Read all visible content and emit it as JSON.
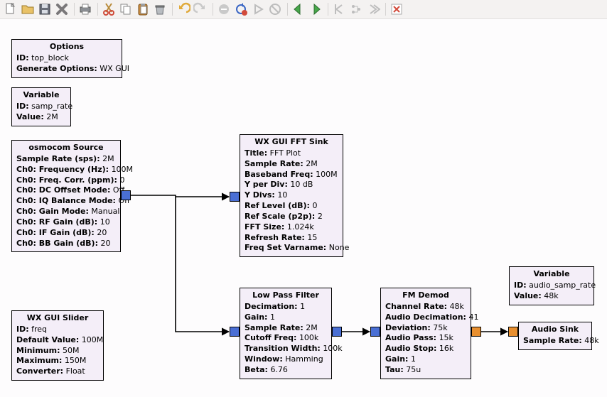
{
  "toolbar": {
    "icons": [
      "new-file-icon",
      "open-folder-icon",
      "save-icon",
      "close-icon",
      "sep",
      "print-icon",
      "sep",
      "cut-icon",
      "copy-icon",
      "paste-icon",
      "delete-icon",
      "sep",
      "undo-icon",
      "redo-icon",
      "sep",
      "stop-icon",
      "rebuild-icon",
      "run-icon",
      "kill-icon",
      "sep",
      "back-icon",
      "forward-icon",
      "sep",
      "collapse-icon",
      "tree-icon",
      "expand-icon",
      "sep",
      "error-icon"
    ]
  },
  "blocks": {
    "options": {
      "title": "Options",
      "rows": [
        {
          "label": "ID:",
          "value": "top_block"
        },
        {
          "label": "Generate Options:",
          "value": "WX GUI"
        }
      ]
    },
    "var_samp_rate": {
      "title": "Variable",
      "rows": [
        {
          "label": "ID:",
          "value": "samp_rate"
        },
        {
          "label": "Value:",
          "value": "2M"
        }
      ]
    },
    "osmocom": {
      "title": "osmocom Source",
      "rows": [
        {
          "label": "Sample Rate (sps):",
          "value": "2M"
        },
        {
          "label": "Ch0: Frequency (Hz):",
          "value": "100M"
        },
        {
          "label": "Ch0: Freq. Corr. (ppm):",
          "value": "0"
        },
        {
          "label": "Ch0: DC Offset Mode:",
          "value": "Off"
        },
        {
          "label": "Ch0: IQ Balance Mode:",
          "value": "Off"
        },
        {
          "label": "Ch0: Gain Mode:",
          "value": "Manual"
        },
        {
          "label": "Ch0: RF Gain (dB):",
          "value": "10"
        },
        {
          "label": "Ch0: IF Gain (dB):",
          "value": "20"
        },
        {
          "label": "Ch0: BB Gain (dB):",
          "value": "20"
        }
      ]
    },
    "fft": {
      "title": "WX GUI FFT Sink",
      "rows": [
        {
          "label": "Title:",
          "value": "FFT Plot"
        },
        {
          "label": "Sample Rate:",
          "value": "2M"
        },
        {
          "label": "Baseband Freq:",
          "value": "100M"
        },
        {
          "label": "Y per Div:",
          "value": "10 dB"
        },
        {
          "label": "Y Divs:",
          "value": "10"
        },
        {
          "label": "Ref Level (dB):",
          "value": "0"
        },
        {
          "label": "Ref Scale (p2p):",
          "value": "2"
        },
        {
          "label": "FFT Size:",
          "value": "1.024k"
        },
        {
          "label": "Refresh Rate:",
          "value": "15"
        },
        {
          "label": "Freq Set Varname:",
          "value": "None"
        }
      ]
    },
    "slider": {
      "title": "WX GUI Slider",
      "rows": [
        {
          "label": "ID:",
          "value": "freq"
        },
        {
          "label": "Default Value:",
          "value": "100M"
        },
        {
          "label": "Minimum:",
          "value": "50M"
        },
        {
          "label": "Maximum:",
          "value": "150M"
        },
        {
          "label": "Converter:",
          "value": "Float"
        }
      ]
    },
    "lpf": {
      "title": "Low Pass Filter",
      "rows": [
        {
          "label": "Decimation:",
          "value": "1"
        },
        {
          "label": "Gain:",
          "value": "1"
        },
        {
          "label": "Sample Rate:",
          "value": "2M"
        },
        {
          "label": "Cutoff Freq:",
          "value": "100k"
        },
        {
          "label": "Transition Width:",
          "value": "100k"
        },
        {
          "label": "Window:",
          "value": "Hamming"
        },
        {
          "label": "Beta:",
          "value": "6.76"
        }
      ]
    },
    "fm": {
      "title": "FM Demod",
      "rows": [
        {
          "label": "Channel Rate:",
          "value": "48k"
        },
        {
          "label": "Audio Decimation:",
          "value": "41"
        },
        {
          "label": "Deviation:",
          "value": "75k"
        },
        {
          "label": "Audio Pass:",
          "value": "15k"
        },
        {
          "label": "Audio Stop:",
          "value": "16k"
        },
        {
          "label": "Gain:",
          "value": "1"
        },
        {
          "label": "Tau:",
          "value": "75u"
        }
      ]
    },
    "var_audio": {
      "title": "Variable",
      "rows": [
        {
          "label": "ID:",
          "value": "audio_samp_rate"
        },
        {
          "label": "Value:",
          "value": "48k"
        }
      ]
    },
    "audio_sink": {
      "title": "Audio Sink",
      "rows": [
        {
          "label": "Sample Rate:",
          "value": "48k"
        }
      ]
    }
  }
}
